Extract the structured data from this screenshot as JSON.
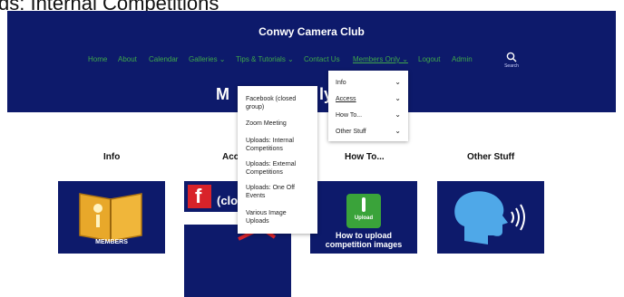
{
  "caption": "ds: Internal Competitions",
  "site": {
    "title": "Conwy Camera Club"
  },
  "nav": {
    "items": [
      {
        "label": "Home"
      },
      {
        "label": "About"
      },
      {
        "label": "Calendar"
      },
      {
        "label": "Galleries ⌄"
      },
      {
        "label": "Tips & Tutorials ⌄"
      },
      {
        "label": "Contact Us"
      },
      {
        "label": "Members Only ⌄"
      },
      {
        "label": "Logout"
      },
      {
        "label": "Admin"
      }
    ],
    "search_label": "Search"
  },
  "page": {
    "heading": "M",
    "heading_tail": "ly"
  },
  "members_menu": {
    "items": [
      {
        "label": "Info",
        "chevron": "⌄"
      },
      {
        "label": "Access",
        "chevron": "⌄"
      },
      {
        "label": "How To...",
        "chevron": "⌄"
      },
      {
        "label": "Other Stuff",
        "chevron": "⌄"
      }
    ]
  },
  "access_submenu": {
    "items": [
      {
        "label": "Facebook (closed group)"
      },
      {
        "label": "Zoom Meeting"
      },
      {
        "label": "Uploads: Internal Competitions"
      },
      {
        "label": "Uploads: External Competitions"
      },
      {
        "label": "Uploads: One Off Events"
      },
      {
        "label": "Various Image Uploads"
      }
    ]
  },
  "sections": [
    {
      "title": "Info"
    },
    {
      "title": "Acc"
    },
    {
      "title": "How To..."
    },
    {
      "title": "Other Stuff"
    }
  ],
  "tiles": {
    "info_caption": "MEMBERS",
    "facebook_text": "(clo",
    "upload_button": "Upload",
    "upload_caption_line1": "How to upload",
    "upload_caption_line2": "competition images"
  },
  "colors": {
    "header_bg": "#0d1a6b",
    "nav_text": "#3fa84a",
    "book": "#e8a82a",
    "upload_green": "#3aa33a"
  }
}
